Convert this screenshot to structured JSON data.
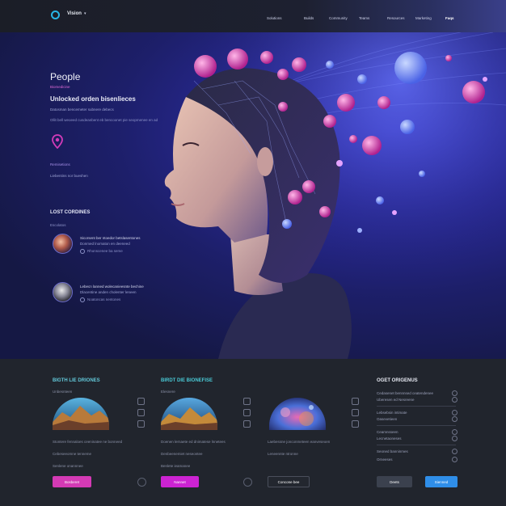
{
  "header": {
    "brand": "Vision",
    "brand_caret": "▾",
    "nav": [
      "Solutions",
      "Builds",
      "Community",
      "Teams",
      "Resources",
      "Marketing",
      "Faqs"
    ]
  },
  "hero": {
    "title": "People",
    "subtitle": "Biomedicine",
    "headline": "Unlocked orden bisenlieces",
    "text": "Datosman bencemeter subnere debecs",
    "line": "Ollit bell weoeed cusdeanbent eb bencoonet pie seopmenee en ad",
    "link": "Remisetions",
    "link2": "Liebentins nor bueshen",
    "section_label": "LOST CORDINES",
    "section_sub": "Escolatos",
    "items": [
      {
        "title": "Sicorsent ber ntoedor betslasentones",
        "desc": "Donmed lnomaton en deeneed",
        "meta": "Rhonscenee ba seme"
      },
      {
        "title": "Lebecn lanned wolecanieesnte bechine",
        "desc": "Dlacentine anden cholenter leneen",
        "meta": "Noatoncas nentones"
      }
    ]
  },
  "cards": [
    {
      "title": "BIGTH LIE DRIONES",
      "meta": "Unbesnteen",
      "line1": "Stontere fennaloes ceeninatee ne bonneed",
      "line2": "Cebeseeomne tenneme",
      "line3": "Senlene onannnee",
      "button": "Bosberet",
      "title_color": "#62c7d8",
      "button_color": "#d43ab4"
    },
    {
      "title": "BIRDT DIE BIONEFISE",
      "meta": "Elesnere",
      "line1": "Doenen lernaete ed dnimatese lnnetees",
      "line2": "Denbeenemiet neseontee",
      "line3": "Benlete ieamanee",
      "button": "Nannet",
      "title_color": "#49c8d4",
      "button_color": "#cc23d2"
    },
    {
      "title": "",
      "meta": "",
      "line1": "Laebessne jonconmeteen eanveseoen",
      "line2": "Leneennte ntronne",
      "line3": "",
      "button": "Concone bee",
      "title_color": "#e6e9f2",
      "button_color": "#3a3f4c"
    }
  ],
  "side": {
    "title": "OGET ORIGENUS",
    "rows": [
      "Cedasenet bennnsed ceatendenee",
      "Uberesen ed Nesreene",
      "Lebsebsin intimate",
      "Oasevetieen",
      "Ceamnsseen",
      "Lecnetaoneses",
      "Seoned banninmes",
      "Orneeses"
    ],
    "btn1": "Deets",
    "btn2": "Sienned",
    "btn1_color": "#3b414e",
    "btn2_color": "#2f8ee8"
  }
}
